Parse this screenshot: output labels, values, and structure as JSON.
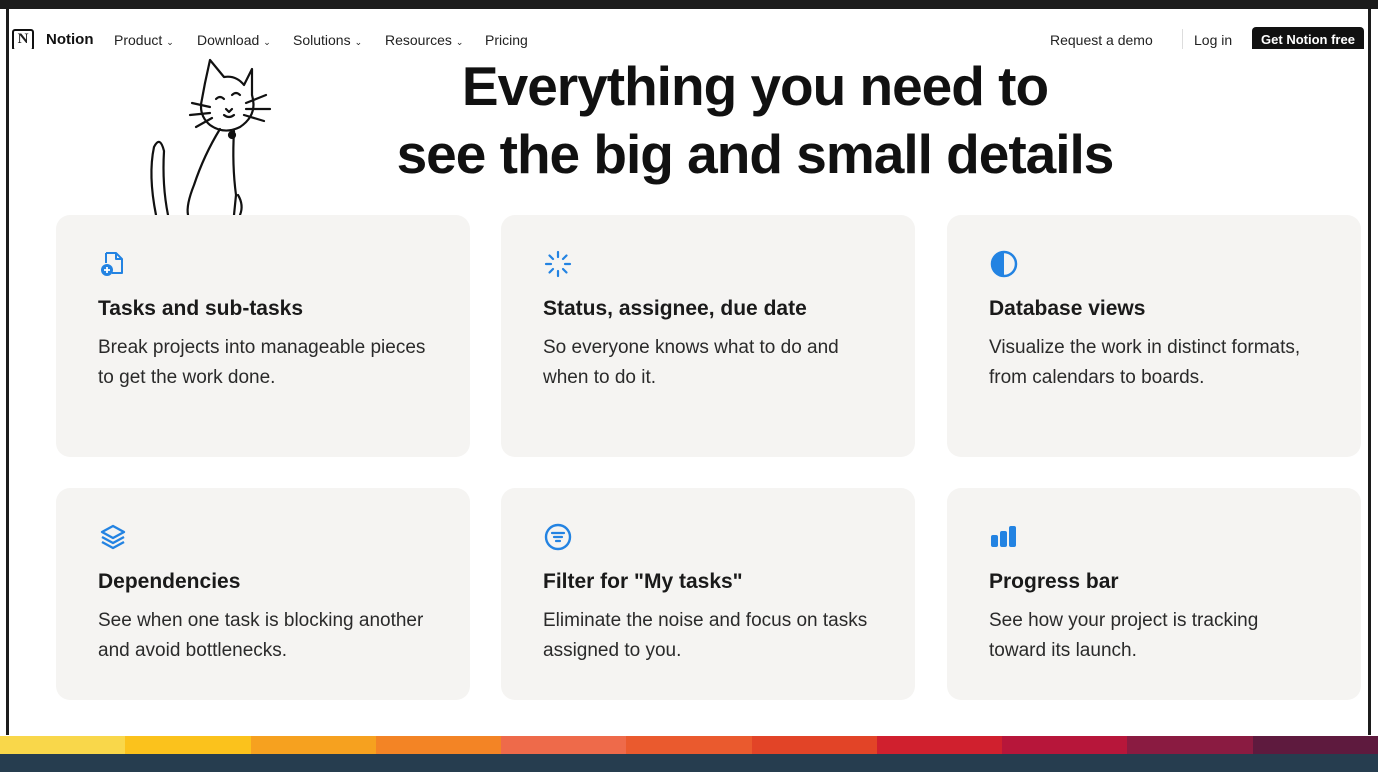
{
  "nav": {
    "brand": "Notion",
    "items": [
      {
        "label": "Product",
        "dropdown": true
      },
      {
        "label": "Download",
        "dropdown": true
      },
      {
        "label": "Solutions",
        "dropdown": true
      },
      {
        "label": "Resources",
        "dropdown": true
      },
      {
        "label": "Pricing",
        "dropdown": false
      }
    ],
    "request_demo": "Request a demo",
    "login": "Log in",
    "cta": "Get Notion free"
  },
  "headline": {
    "line1": "Everything you need to",
    "line2": "see the big and small details"
  },
  "cards": [
    {
      "icon": "document-plus-icon",
      "title": "Tasks and sub-tasks",
      "desc": "Break projects into manageable pieces to get the work done."
    },
    {
      "icon": "loading-spinner-icon",
      "title": "Status, assignee, due date",
      "desc": "So everyone knows what to do and when to do it."
    },
    {
      "icon": "half-circle-icon",
      "title": "Database views",
      "desc": "Visualize the work in distinct formats, from calendars to boards."
    },
    {
      "icon": "layers-icon",
      "title": "Dependencies",
      "desc": "See when one task is blocking another and avoid bottlenecks."
    },
    {
      "icon": "filter-icon",
      "title": "Filter for \"My tasks\"",
      "desc": "Eliminate the noise and focus on tasks assigned to you."
    },
    {
      "icon": "bar-chart-icon",
      "title": "Progress bar",
      "desc": "See how your project is tracking toward its launch."
    }
  ],
  "colors": {
    "accent": "#2383e2",
    "card_bg": "#f5f4f2",
    "cta_bg": "#111111",
    "bottom_bar": "#263d4f",
    "stripes": [
      "#f9d74a",
      "#fbc21c",
      "#f6a11f",
      "#f38425",
      "#ee6a4a",
      "#ea5a2e",
      "#e24427",
      "#d0202e",
      "#b7163a",
      "#8a1b41",
      "#5e1a3e"
    ]
  }
}
